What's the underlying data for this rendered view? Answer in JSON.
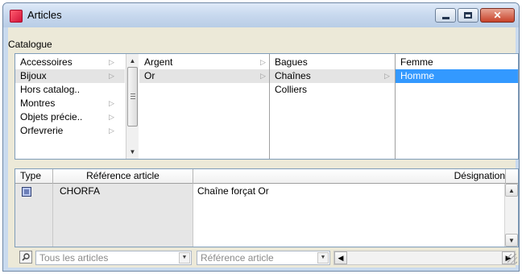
{
  "window": {
    "title": "Articles",
    "accent": "#c9daee"
  },
  "catalog": {
    "label": "Catalogue",
    "columns": [
      {
        "items": [
          "Accessoires",
          "Bijoux",
          "Hors catalog..",
          "Montres",
          "Objets précie..",
          "Orfevrerie"
        ],
        "has_children": [
          true,
          true,
          false,
          true,
          true,
          true
        ],
        "selected": 1
      },
      {
        "items": [
          "Argent",
          "Or"
        ],
        "has_children": [
          true,
          true
        ],
        "selected": 1
      },
      {
        "items": [
          "Bagues",
          "Chaînes",
          "Colliers"
        ],
        "has_children": [
          false,
          true,
          false
        ],
        "selected": 1
      },
      {
        "items": [
          "Femme",
          "Homme"
        ],
        "has_children": [
          false,
          false
        ],
        "selected": 1
      }
    ]
  },
  "grid": {
    "headers": {
      "type": "Type",
      "ref": "Référence article",
      "desc": "Désignation"
    },
    "rows": [
      {
        "type_icon": "article-icon",
        "ref": "CHORFA",
        "desc": "Chaîne forçat Or"
      }
    ]
  },
  "filters": {
    "scope": "Tous les articles",
    "field": "Référence article"
  },
  "colors": {
    "selection": "#3399ff",
    "gray_selection": "#e4e4e4",
    "close_button": "#c8432a"
  }
}
